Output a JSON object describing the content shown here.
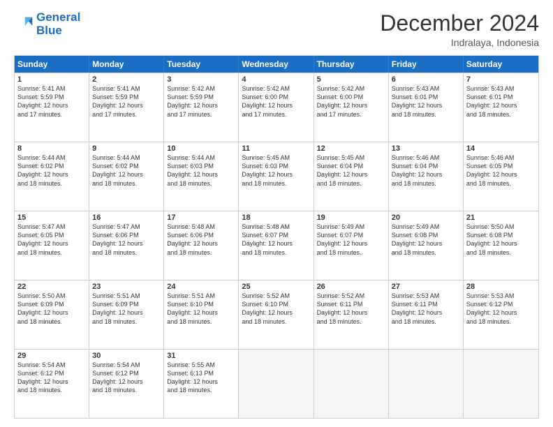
{
  "logo": {
    "line1": "General",
    "line2": "Blue"
  },
  "title": "December 2024",
  "subtitle": "Indralaya, Indonesia",
  "header_days": [
    "Sunday",
    "Monday",
    "Tuesday",
    "Wednesday",
    "Thursday",
    "Friday",
    "Saturday"
  ],
  "weeks": [
    [
      {
        "day": "1",
        "info": "Sunrise: 5:41 AM\nSunset: 5:59 PM\nDaylight: 12 hours\nand 17 minutes."
      },
      {
        "day": "2",
        "info": "Sunrise: 5:41 AM\nSunset: 5:59 PM\nDaylight: 12 hours\nand 17 minutes."
      },
      {
        "day": "3",
        "info": "Sunrise: 5:42 AM\nSunset: 5:59 PM\nDaylight: 12 hours\nand 17 minutes."
      },
      {
        "day": "4",
        "info": "Sunrise: 5:42 AM\nSunset: 6:00 PM\nDaylight: 12 hours\nand 17 minutes."
      },
      {
        "day": "5",
        "info": "Sunrise: 5:42 AM\nSunset: 6:00 PM\nDaylight: 12 hours\nand 17 minutes."
      },
      {
        "day": "6",
        "info": "Sunrise: 5:43 AM\nSunset: 6:01 PM\nDaylight: 12 hours\nand 18 minutes."
      },
      {
        "day": "7",
        "info": "Sunrise: 5:43 AM\nSunset: 6:01 PM\nDaylight: 12 hours\nand 18 minutes."
      }
    ],
    [
      {
        "day": "8",
        "info": "Sunrise: 5:44 AM\nSunset: 6:02 PM\nDaylight: 12 hours\nand 18 minutes."
      },
      {
        "day": "9",
        "info": "Sunrise: 5:44 AM\nSunset: 6:02 PM\nDaylight: 12 hours\nand 18 minutes."
      },
      {
        "day": "10",
        "info": "Sunrise: 5:44 AM\nSunset: 6:03 PM\nDaylight: 12 hours\nand 18 minutes."
      },
      {
        "day": "11",
        "info": "Sunrise: 5:45 AM\nSunset: 6:03 PM\nDaylight: 12 hours\nand 18 minutes."
      },
      {
        "day": "12",
        "info": "Sunrise: 5:45 AM\nSunset: 6:04 PM\nDaylight: 12 hours\nand 18 minutes."
      },
      {
        "day": "13",
        "info": "Sunrise: 5:46 AM\nSunset: 6:04 PM\nDaylight: 12 hours\nand 18 minutes."
      },
      {
        "day": "14",
        "info": "Sunrise: 5:46 AM\nSunset: 6:05 PM\nDaylight: 12 hours\nand 18 minutes."
      }
    ],
    [
      {
        "day": "15",
        "info": "Sunrise: 5:47 AM\nSunset: 6:05 PM\nDaylight: 12 hours\nand 18 minutes."
      },
      {
        "day": "16",
        "info": "Sunrise: 5:47 AM\nSunset: 6:06 PM\nDaylight: 12 hours\nand 18 minutes."
      },
      {
        "day": "17",
        "info": "Sunrise: 5:48 AM\nSunset: 6:06 PM\nDaylight: 12 hours\nand 18 minutes."
      },
      {
        "day": "18",
        "info": "Sunrise: 5:48 AM\nSunset: 6:07 PM\nDaylight: 12 hours\nand 18 minutes."
      },
      {
        "day": "19",
        "info": "Sunrise: 5:49 AM\nSunset: 6:07 PM\nDaylight: 12 hours\nand 18 minutes."
      },
      {
        "day": "20",
        "info": "Sunrise: 5:49 AM\nSunset: 6:08 PM\nDaylight: 12 hours\nand 18 minutes."
      },
      {
        "day": "21",
        "info": "Sunrise: 5:50 AM\nSunset: 6:08 PM\nDaylight: 12 hours\nand 18 minutes."
      }
    ],
    [
      {
        "day": "22",
        "info": "Sunrise: 5:50 AM\nSunset: 6:09 PM\nDaylight: 12 hours\nand 18 minutes."
      },
      {
        "day": "23",
        "info": "Sunrise: 5:51 AM\nSunset: 6:09 PM\nDaylight: 12 hours\nand 18 minutes."
      },
      {
        "day": "24",
        "info": "Sunrise: 5:51 AM\nSunset: 6:10 PM\nDaylight: 12 hours\nand 18 minutes."
      },
      {
        "day": "25",
        "info": "Sunrise: 5:52 AM\nSunset: 6:10 PM\nDaylight: 12 hours\nand 18 minutes."
      },
      {
        "day": "26",
        "info": "Sunrise: 5:52 AM\nSunset: 6:11 PM\nDaylight: 12 hours\nand 18 minutes."
      },
      {
        "day": "27",
        "info": "Sunrise: 5:53 AM\nSunset: 6:11 PM\nDaylight: 12 hours\nand 18 minutes."
      },
      {
        "day": "28",
        "info": "Sunrise: 5:53 AM\nSunset: 6:12 PM\nDaylight: 12 hours\nand 18 minutes."
      }
    ],
    [
      {
        "day": "29",
        "info": "Sunrise: 5:54 AM\nSunset: 6:12 PM\nDaylight: 12 hours\nand 18 minutes."
      },
      {
        "day": "30",
        "info": "Sunrise: 5:54 AM\nSunset: 6:12 PM\nDaylight: 12 hours\nand 18 minutes."
      },
      {
        "day": "31",
        "info": "Sunrise: 5:55 AM\nSunset: 6:13 PM\nDaylight: 12 hours\nand 18 minutes."
      },
      {
        "day": "",
        "info": ""
      },
      {
        "day": "",
        "info": ""
      },
      {
        "day": "",
        "info": ""
      },
      {
        "day": "",
        "info": ""
      }
    ]
  ]
}
